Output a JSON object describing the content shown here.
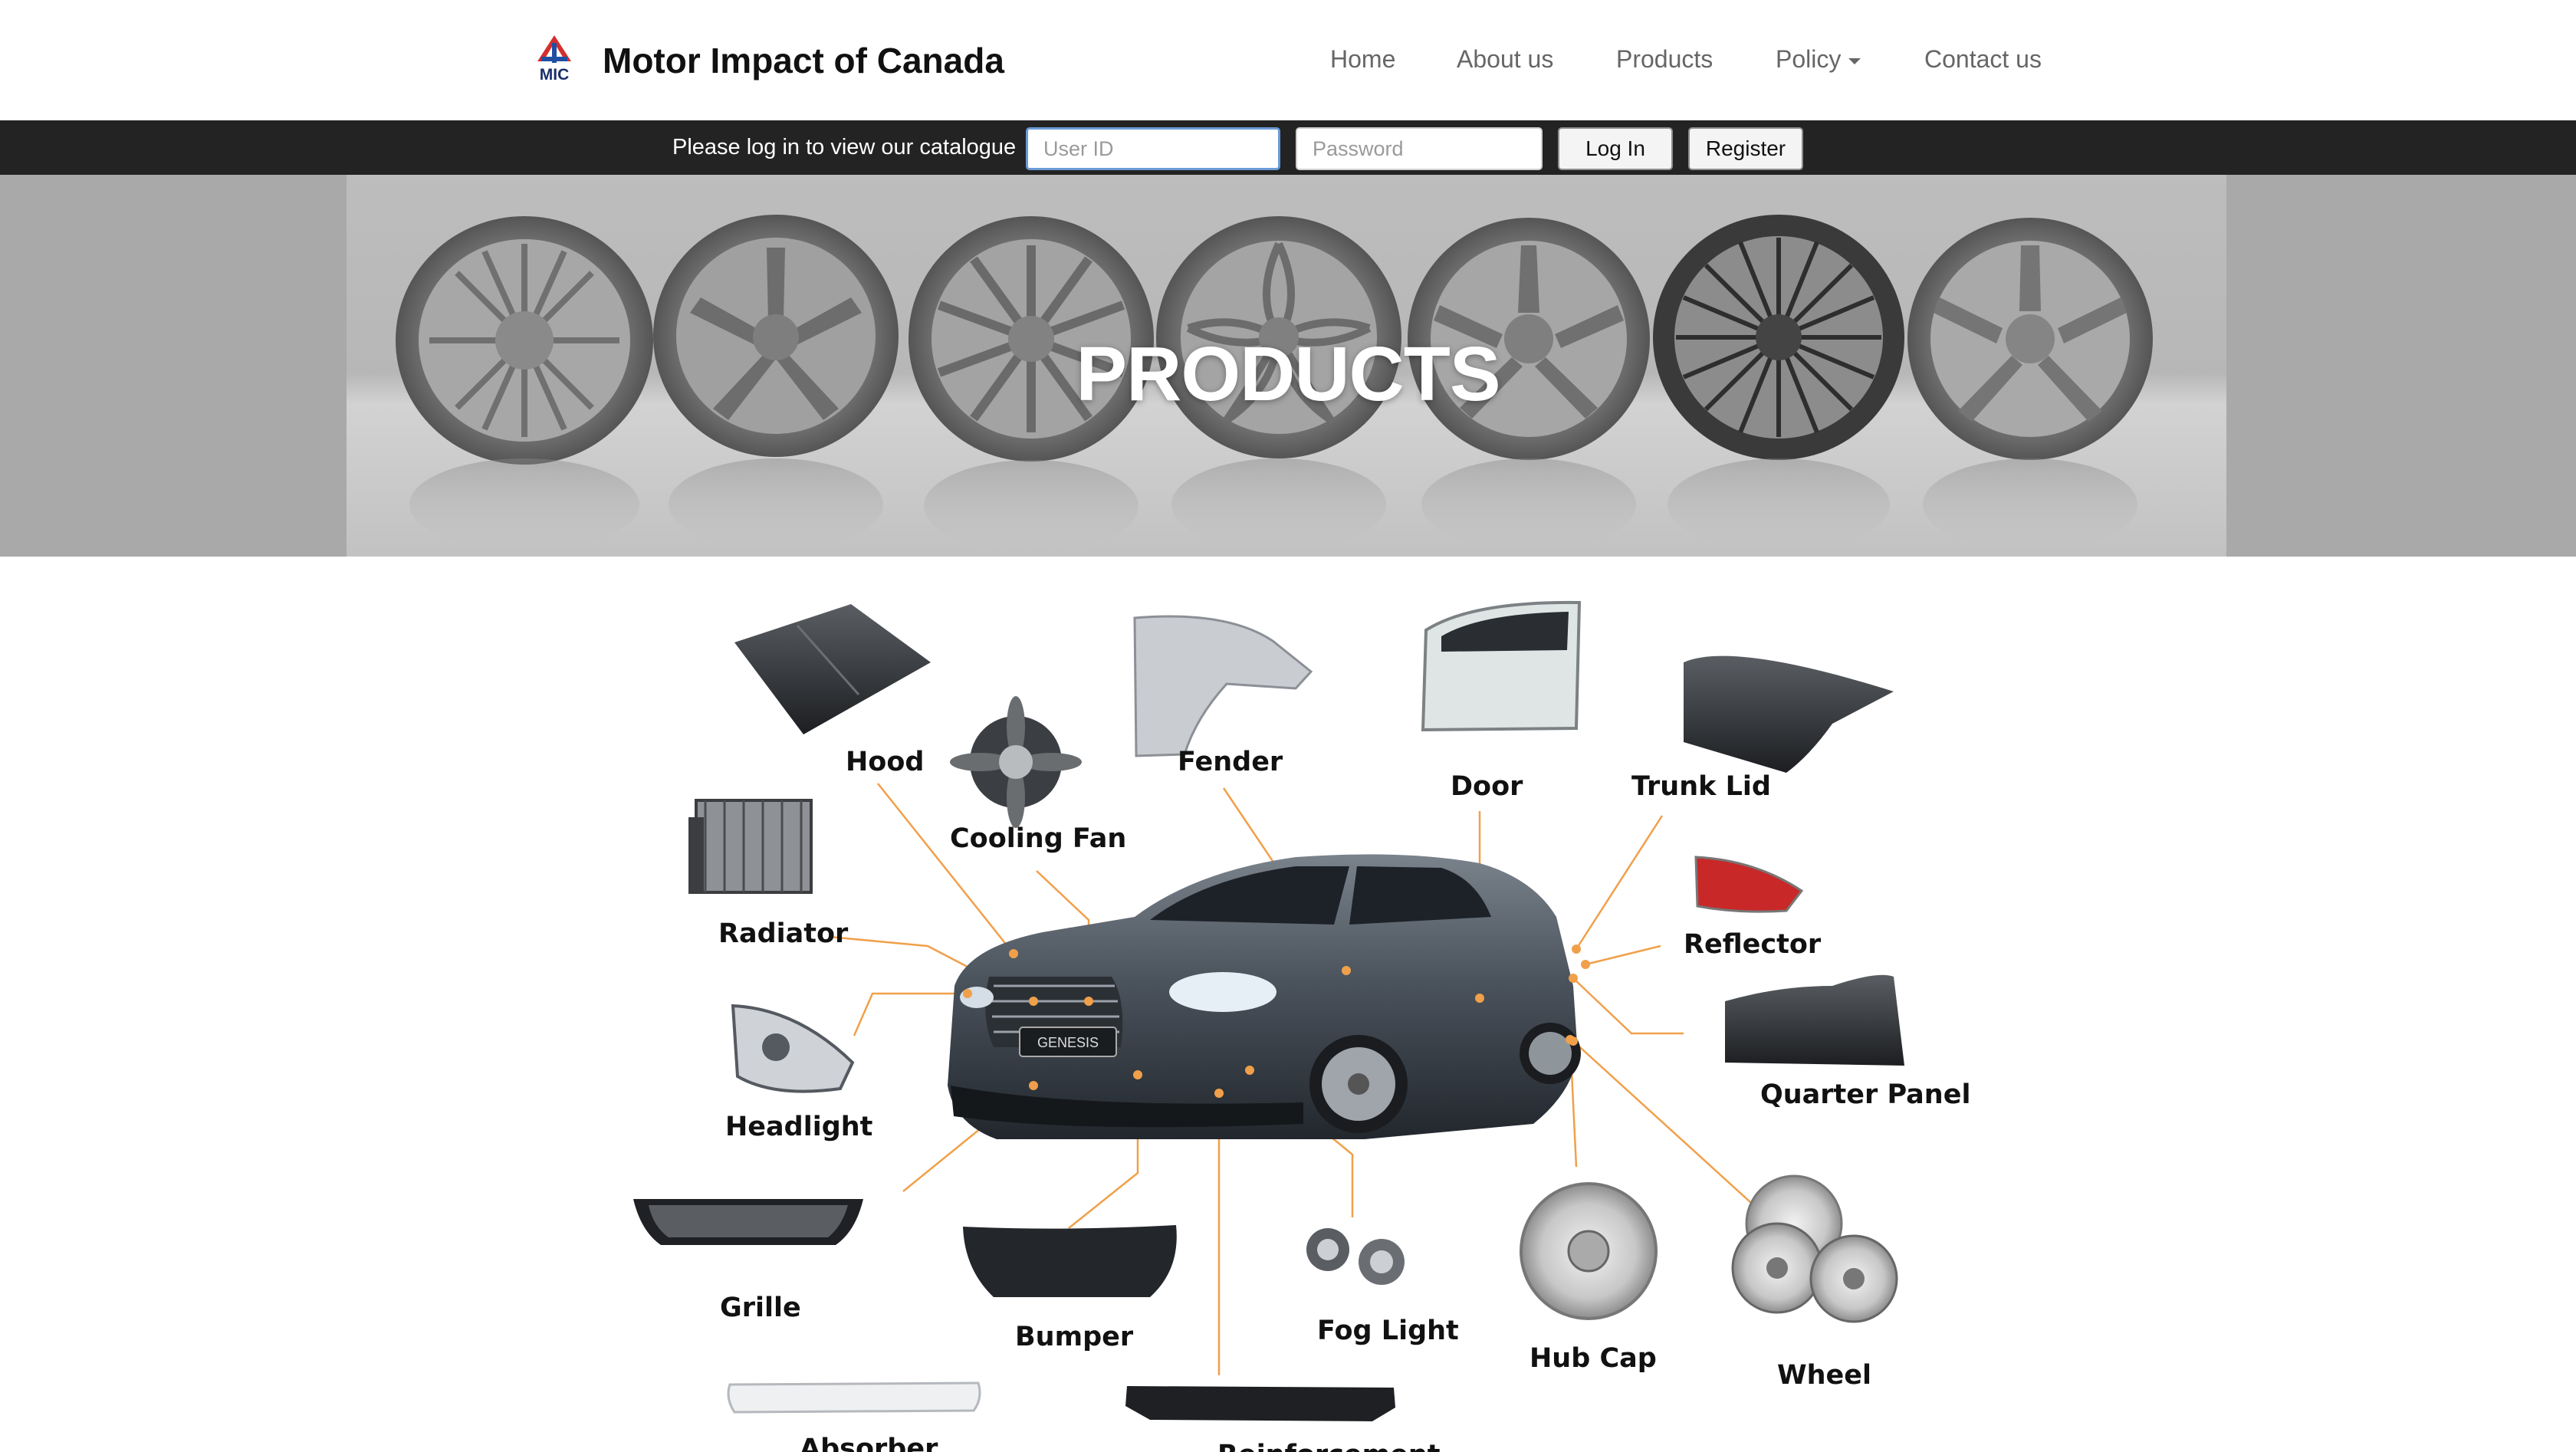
{
  "header": {
    "brand": "Motor Impact of Canada",
    "logo_text": "MIC",
    "nav": [
      {
        "label": "Home"
      },
      {
        "label": "About us"
      },
      {
        "label": "Products"
      },
      {
        "label": "Policy",
        "icon": "caret-down-icon"
      },
      {
        "label": "Contact us"
      }
    ]
  },
  "login": {
    "message": "Please log in to view our catalogue",
    "user_placeholder": "User ID",
    "user_value": "",
    "password_placeholder": "Password",
    "password_value": "",
    "login_label": "Log In",
    "register_label": "Register"
  },
  "banner": {
    "title": "PRODUCTS"
  },
  "diagram": {
    "car_badge": "GENESIS",
    "parts": [
      "Hood",
      "Cooling Fan",
      "Fender",
      "Door",
      "Trunk Lid",
      "Radiator",
      "Reflector",
      "Headlight",
      "Quarter Panel",
      "Grille",
      "Bumper",
      "Fog Light",
      "Hub Cap",
      "Wheel",
      "Absorber",
      "Reinforcement"
    ]
  },
  "colors": {
    "header_bg": "#ffffff",
    "login_bar_bg": "#232323",
    "banner_bg": "#a9a9a9",
    "leader_line": "#f0a04a",
    "nav_text": "#666666",
    "logo_red": "#d32f2f",
    "logo_blue": "#1f4fa3"
  }
}
